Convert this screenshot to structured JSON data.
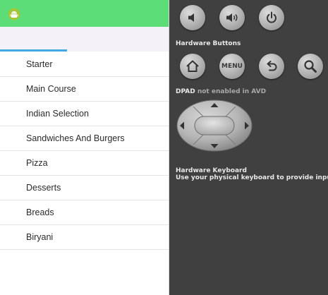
{
  "app": {
    "icon": "android-icon",
    "action_bar_color": "#5cdd77",
    "tab_indicator_color": "#43a9e2"
  },
  "menu": {
    "items": [
      {
        "label": "Starter"
      },
      {
        "label": "Main Course"
      },
      {
        "label": "Indian Selection"
      },
      {
        "label": "Sandwiches And Burgers"
      },
      {
        "label": "Pizza"
      },
      {
        "label": "Desserts"
      },
      {
        "label": "Breads"
      },
      {
        "label": "Biryani"
      }
    ]
  },
  "controls": {
    "basic": {
      "buttons": [
        {
          "icon": "volume-down-icon"
        },
        {
          "icon": "volume-up-icon"
        },
        {
          "icon": "power-icon"
        }
      ]
    },
    "hardware": {
      "title": "Hardware Buttons",
      "buttons": [
        {
          "icon": "home-icon"
        },
        {
          "icon": "menu-button",
          "label": "MENU"
        },
        {
          "icon": "back-icon"
        },
        {
          "icon": "search-icon"
        }
      ]
    },
    "dpad": {
      "title": "DPAD",
      "note": "not enabled in AVD"
    },
    "keyboard": {
      "title": "Hardware Keyboard",
      "note": "Use your physical keyboard to provide input"
    }
  }
}
